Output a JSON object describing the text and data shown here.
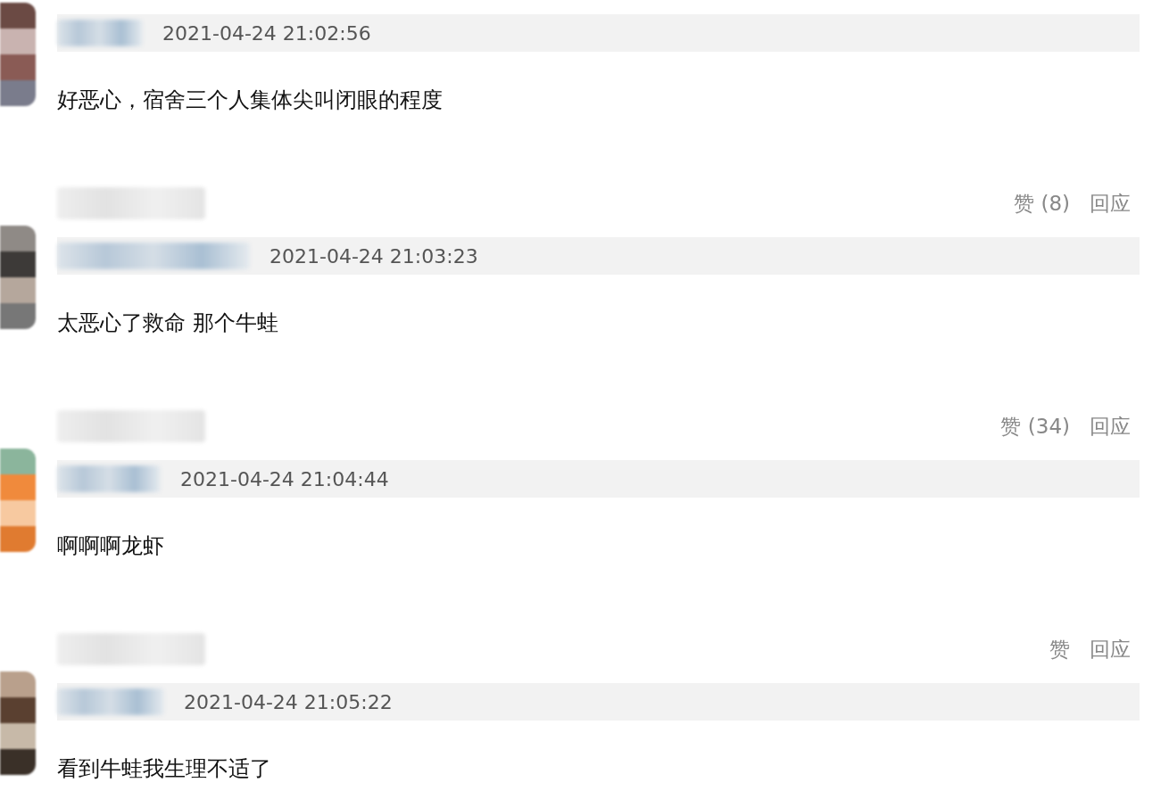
{
  "comments": [
    {
      "time": "2021-04-24 21:02:56",
      "text": "好恶心，宿舍三个人集体尖叫闭眼的程度",
      "footer": {
        "like": "赞 (8)",
        "reply": "回应"
      }
    },
    {
      "time": "2021-04-24 21:03:23",
      "text": "太恶心了救命 那个牛蛙",
      "footer": {
        "like": "赞 (34)",
        "reply": "回应"
      }
    },
    {
      "time": "2021-04-24 21:04:44",
      "text": "啊啊啊龙虾",
      "footer": {
        "like": "赞",
        "reply": "回应"
      }
    },
    {
      "time": "2021-04-24 21:05:22",
      "text": "看到牛蛙我生理不适了"
    }
  ]
}
